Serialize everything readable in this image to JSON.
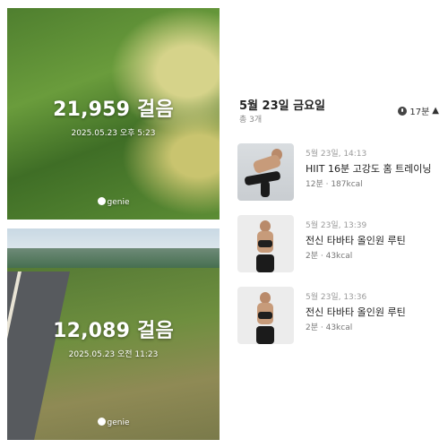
{
  "photos": [
    {
      "steps": "21,959 걸음",
      "timestamp": "2025.05.23 오후 5:23",
      "brand": "genie"
    },
    {
      "steps": "12,089 걸음",
      "timestamp": "2025.05.23 오전 11:23",
      "brand": "genie"
    }
  ],
  "panel": {
    "date_title": "5월 23일 금요일",
    "count": "총 3개",
    "summary_time": "17분",
    "summary_icons": [
      "clock-icon",
      "flame-icon"
    ]
  },
  "workouts": [
    {
      "time": "5월 23일, 14:13",
      "name": "HIIT 16분 고강도 홈 트레이닝",
      "meta": "12분 · 187kcal"
    },
    {
      "time": "5월 23일, 13:39",
      "name": "전신 타바타 올인원 루틴",
      "meta": "2분 · 43kcal"
    },
    {
      "time": "5월 23일, 13:36",
      "name": "전신 타바타 올인원 루틴",
      "meta": "2분 · 43kcal"
    }
  ]
}
